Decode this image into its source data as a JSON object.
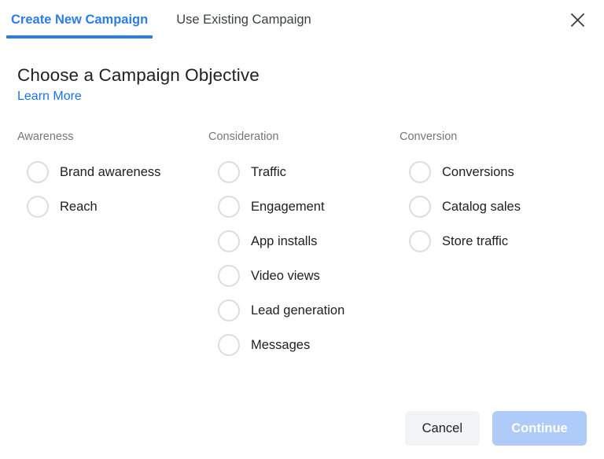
{
  "tabs": [
    {
      "label": "Create New Campaign",
      "active": true
    },
    {
      "label": "Use Existing Campaign",
      "active": false
    }
  ],
  "close_icon": "close-icon",
  "header": {
    "title": "Choose a Campaign Objective",
    "learn_more": "Learn More"
  },
  "columns": [
    {
      "header": "Awareness",
      "options": [
        {
          "label": "Brand awareness",
          "selected": false
        },
        {
          "label": "Reach",
          "selected": false
        }
      ]
    },
    {
      "header": "Consideration",
      "options": [
        {
          "label": "Traffic",
          "selected": false
        },
        {
          "label": "Engagement",
          "selected": false
        },
        {
          "label": "App installs",
          "selected": false
        },
        {
          "label": "Video views",
          "selected": false
        },
        {
          "label": "Lead generation",
          "selected": false
        },
        {
          "label": "Messages",
          "selected": false
        }
      ]
    },
    {
      "header": "Conversion",
      "options": [
        {
          "label": "Conversions",
          "selected": false
        },
        {
          "label": "Catalog sales",
          "selected": false
        },
        {
          "label": "Store traffic",
          "selected": false
        }
      ]
    }
  ],
  "footer": {
    "cancel_label": "Cancel",
    "continue_label": "Continue"
  },
  "colors": {
    "accent_blue": "#2b7de9",
    "link_blue": "#1a73e8",
    "continue_bg": "#aecbfa",
    "cancel_bg": "#f1f3f4",
    "radio_border": "#dcdddf",
    "muted_text": "#747678",
    "body_text": "#202124",
    "background": "#ffffff"
  }
}
